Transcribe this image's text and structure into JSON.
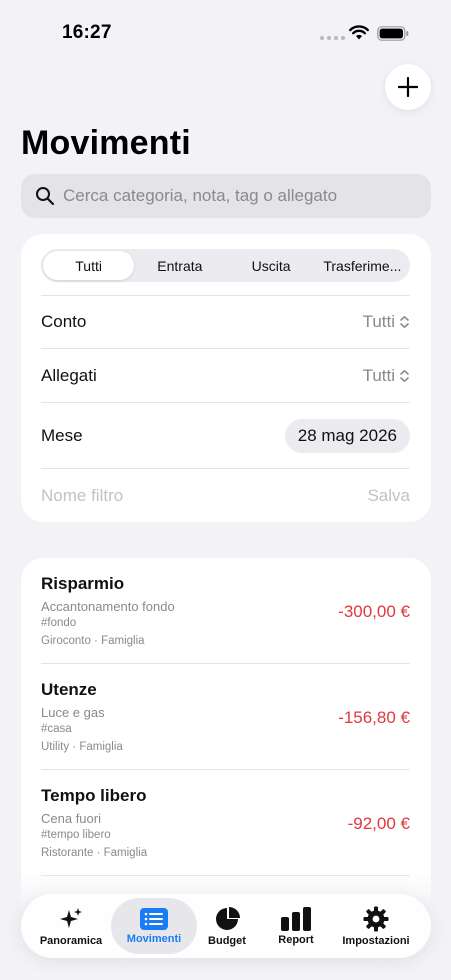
{
  "status_bar": {
    "time": "16:27"
  },
  "header": {
    "title": "Movimenti"
  },
  "search": {
    "placeholder": "Cerca categoria, nota, tag o allegato"
  },
  "segments": [
    {
      "label": "Tutti",
      "active": true
    },
    {
      "label": "Entrata",
      "active": false
    },
    {
      "label": "Uscita",
      "active": false
    },
    {
      "label": "Trasferime...",
      "active": false
    }
  ],
  "filters": {
    "account": {
      "label": "Conto",
      "value": "Tutti"
    },
    "attachments": {
      "label": "Allegati",
      "value": "Tutti"
    },
    "month": {
      "label": "Mese",
      "value": "28 mag 2026"
    },
    "filter_name": {
      "placeholder": "Nome filtro",
      "action": "Salva"
    }
  },
  "transactions": [
    {
      "title": "Risparmio",
      "note": "Accantonamento fondo",
      "tag": "#fondo",
      "meta": "Giroconto · Famiglia",
      "amount": "-300,00 €"
    },
    {
      "title": "Utenze",
      "note": "Luce e gas",
      "tag": "#casa",
      "meta": "Utility · Famiglia",
      "amount": "-156,80 €"
    },
    {
      "title": "Tempo libero",
      "note": "Cena fuori",
      "tag": "#tempo libero",
      "meta": "Ristorante · Famiglia",
      "amount": "-92,00 €"
    }
  ],
  "tab_bar": {
    "tabs": [
      {
        "label": "Panoramica",
        "icon": "sparkles-icon",
        "active": false
      },
      {
        "label": "Movimenti",
        "icon": "list-icon",
        "active": true
      },
      {
        "label": "Budget",
        "icon": "pie-chart-icon",
        "active": false
      },
      {
        "label": "Report",
        "icon": "bar-chart-icon",
        "active": false
      },
      {
        "label": "Impostazioni",
        "icon": "gear-icon",
        "active": false
      }
    ]
  },
  "colors": {
    "accent": "#1a7cf5",
    "negative": "#e0383e",
    "background": "#f2f2f7"
  }
}
